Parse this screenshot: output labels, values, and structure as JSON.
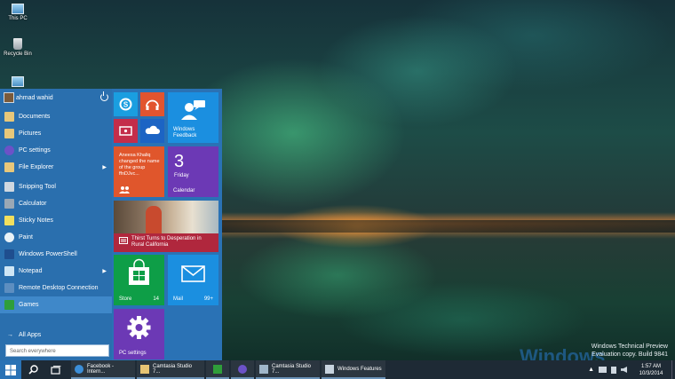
{
  "desktop": {
    "icons": [
      {
        "label": "This PC",
        "icon": "pc-icon"
      },
      {
        "label": "Recycle Bin",
        "icon": "recycle-bin-icon"
      }
    ],
    "watermark": {
      "line1": "Windows Technical Preview",
      "line2": "Evaluation copy. Build 9841",
      "big": "Windows"
    }
  },
  "start_menu": {
    "user_name": "ahmad wahid",
    "apps": [
      {
        "label": "Documents",
        "icon_color": "#e7c77a"
      },
      {
        "label": "Pictures",
        "icon_color": "#e7c77a"
      },
      {
        "label": "PC settings",
        "icon_color": "#6c52c7"
      },
      {
        "label": "File Explorer",
        "icon_color": "#e7c77a"
      },
      {
        "label": "Snipping Tool",
        "icon_color": "#d0d8e0"
      },
      {
        "label": "Calculator",
        "icon_color": "#9aa8b5"
      },
      {
        "label": "Sticky Notes",
        "icon_color": "#f1df5e"
      },
      {
        "label": "Paint",
        "icon_color": "#e9f2f7"
      },
      {
        "label": "Windows PowerShell",
        "icon_color": "#1f4e8f"
      },
      {
        "label": "Notepad",
        "icon_color": "#cfe6f5"
      },
      {
        "label": "Remote Desktop Connection",
        "icon_color": "#5d8ec0"
      },
      {
        "label": "Games",
        "icon_color": "#2f9e3a"
      }
    ],
    "all_apps_label": "All Apps",
    "search_placeholder": "Search everywhere",
    "tiles": {
      "feedback_label": "Windows Feedback",
      "people_text": "Aneesa Khaliq changed the name of the group ffnDJvc...",
      "calendar_number": "3",
      "calendar_day": "Friday",
      "calendar_label": "Calendar",
      "news_headline": "Thirst Turns to Desperation in Rural California",
      "store_label": "Store",
      "store_badge": "14",
      "mail_label": "Mail",
      "mail_badge": "99+",
      "pc_settings_label": "PC settings"
    }
  },
  "taskbar": {
    "tasks": [
      {
        "label": "Facebook - Intern...",
        "icon_color": "#3b8ed8"
      },
      {
        "label": "Camtasia Studio 7...",
        "icon_color": "#e6c574"
      },
      {
        "label": "",
        "icon_color": "#2f9e3a"
      },
      {
        "label": "",
        "icon_color": "#6c52c7"
      },
      {
        "label": "Camtasia Studio 7...",
        "icon_color": "#9fb6c9"
      },
      {
        "label": "Windows Features",
        "icon_color": "#c7d3de"
      }
    ],
    "clock_time": "1:57 AM",
    "clock_date": "10/3/2014"
  }
}
